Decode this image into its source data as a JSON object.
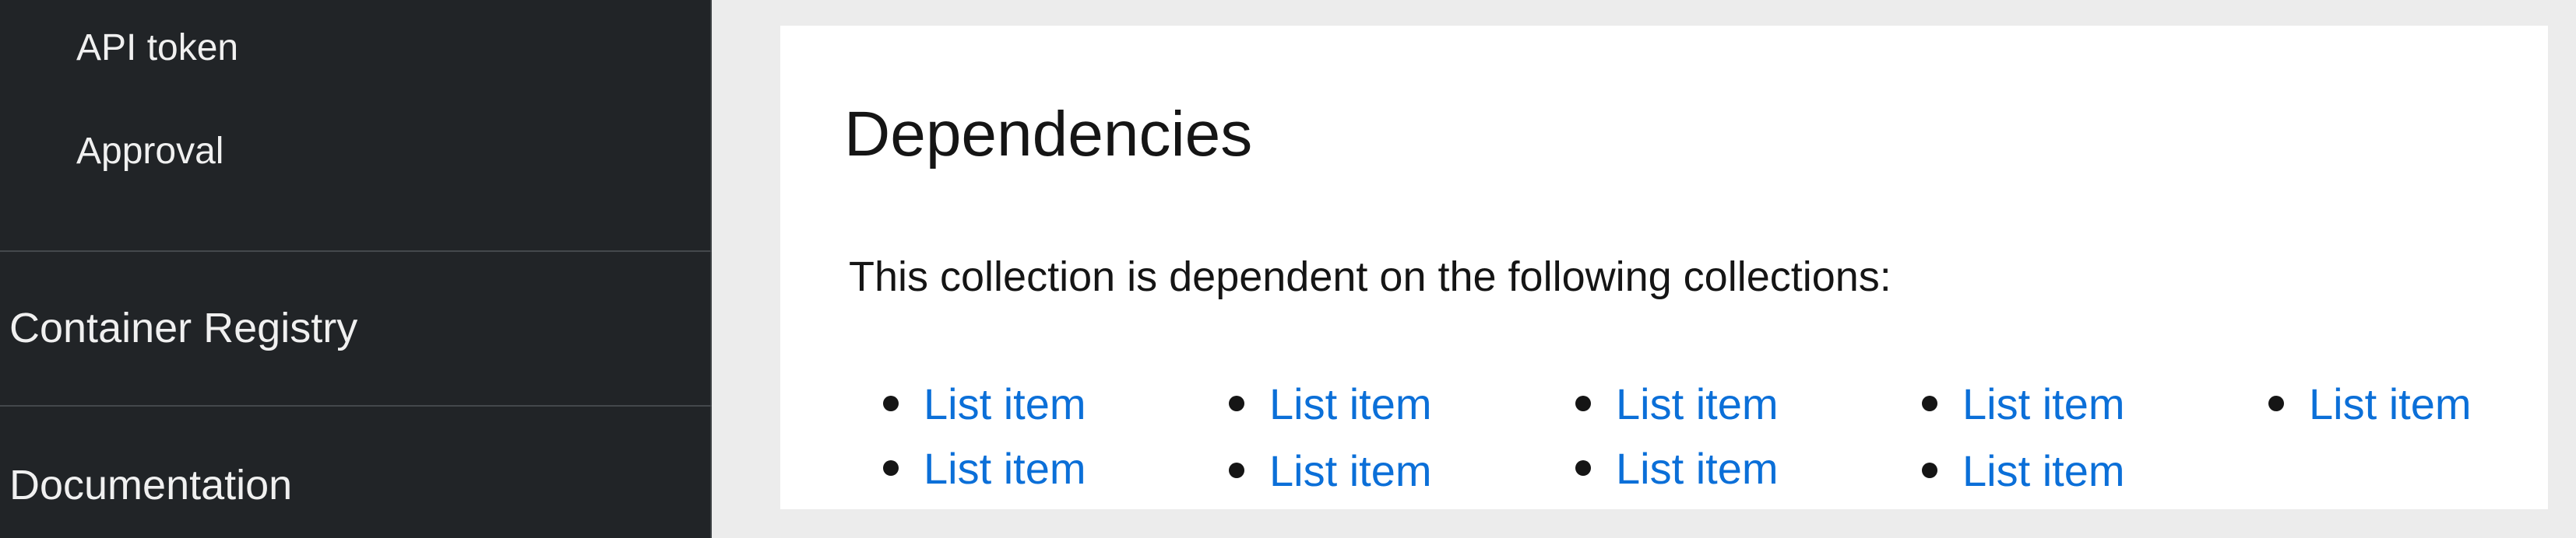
{
  "sidebar": {
    "sub_items": [
      {
        "label": "API token"
      },
      {
        "label": "Approval"
      }
    ],
    "sections": [
      {
        "label": "Container Registry"
      },
      {
        "label": "Documentation"
      }
    ]
  },
  "main": {
    "title": "Dependencies",
    "description": "This collection is dependent on the following collections:",
    "dependencies": [
      {
        "label": "List item"
      },
      {
        "label": "List item"
      },
      {
        "label": "List item"
      },
      {
        "label": "List item"
      },
      {
        "label": "List item"
      },
      {
        "label": "List item"
      },
      {
        "label": "List item"
      },
      {
        "label": "List item"
      },
      {
        "label": "List item"
      }
    ]
  },
  "colors": {
    "sidebar_bg": "#212427",
    "page_bg": "#ececec",
    "link": "#0b6fd8",
    "text": "#151515"
  }
}
